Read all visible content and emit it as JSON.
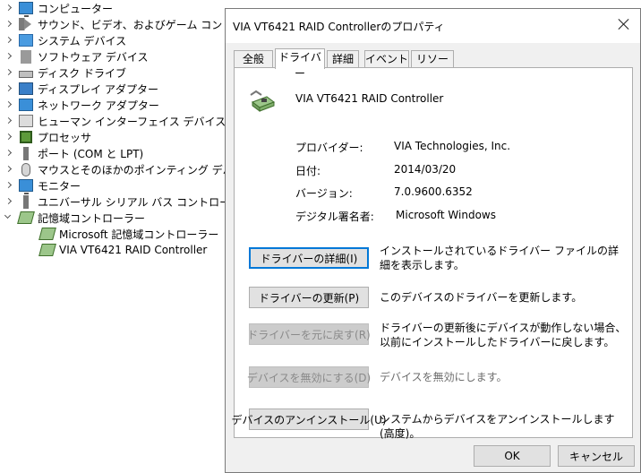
{
  "tree": {
    "items": [
      {
        "label": "コンピューター",
        "icon": "computer-icon",
        "expanded": false
      },
      {
        "label": "サウンド、ビデオ、およびゲーム コントローラー",
        "icon": "speaker-icon",
        "expanded": false
      },
      {
        "label": "システム デバイス",
        "icon": "system-device-icon",
        "expanded": false
      },
      {
        "label": "ソフトウェア デバイス",
        "icon": "software-device-icon",
        "expanded": false
      },
      {
        "label": "ディスク ドライブ",
        "icon": "disk-drive-icon",
        "expanded": false
      },
      {
        "label": "ディスプレイ アダプター",
        "icon": "display-adapter-icon",
        "expanded": false
      },
      {
        "label": "ネットワーク アダプター",
        "icon": "network-adapter-icon",
        "expanded": false
      },
      {
        "label": "ヒューマン インターフェイス デバイス",
        "icon": "hid-icon",
        "expanded": false
      },
      {
        "label": "プロセッサ",
        "icon": "processor-icon",
        "expanded": false
      },
      {
        "label": "ポート (COM と LPT)",
        "icon": "port-icon",
        "expanded": false
      },
      {
        "label": "マウスとそのほかのポインティング デバイス",
        "icon": "mouse-icon",
        "expanded": false
      },
      {
        "label": "モニター",
        "icon": "monitor-icon",
        "expanded": false
      },
      {
        "label": "ユニバーサル シリアル バス コントローラー",
        "icon": "usb-icon",
        "expanded": false
      },
      {
        "label": "記憶域コントローラー",
        "icon": "storage-controller-icon",
        "expanded": true
      }
    ],
    "children": [
      {
        "label": "Microsoft 記憶域コントローラー",
        "icon": "storage-controller-icon"
      },
      {
        "label": "VIA VT6421 RAID Controller",
        "icon": "storage-controller-icon"
      }
    ]
  },
  "dialog": {
    "title": "VIA VT6421 RAID Controllerのプロパティ",
    "tabs": [
      "全般",
      "ドライバー",
      "詳細",
      "イベント",
      "リソース"
    ],
    "active_tab": "ドライバー",
    "device_name": "VIA VT6421 RAID Controller",
    "info": [
      {
        "label": "プロバイダー:",
        "value": "VIA Technologies, Inc."
      },
      {
        "label": "日付:",
        "value": "2014/03/20"
      },
      {
        "label": "バージョン:",
        "value": "7.0.9600.6352"
      },
      {
        "label": "デジタル署名者:",
        "value": "Microsoft Windows"
      }
    ],
    "actions": [
      {
        "label": "ドライバーの詳細(I)",
        "desc": "インストールされているドライバー ファイルの詳細を表示します。",
        "enabled": true
      },
      {
        "label": "ドライバーの更新(P)",
        "desc": "このデバイスのドライバーを更新します。",
        "enabled": true
      },
      {
        "label": "ドライバーを元に戻す(R)",
        "desc": "ドライバーの更新後にデバイスが動作しない場合、以前にインストールしたドライバーに戻します。",
        "enabled": false
      },
      {
        "label": "デバイスを無効にする(D)",
        "desc": "デバイスを無効にします。",
        "enabled": false
      },
      {
        "label": "デバイスのアンインストール(U)",
        "desc": "システムからデバイスをアンインストールします (高度)。",
        "enabled": true
      }
    ],
    "ok_label": "OK",
    "cancel_label": "キャンセル"
  }
}
